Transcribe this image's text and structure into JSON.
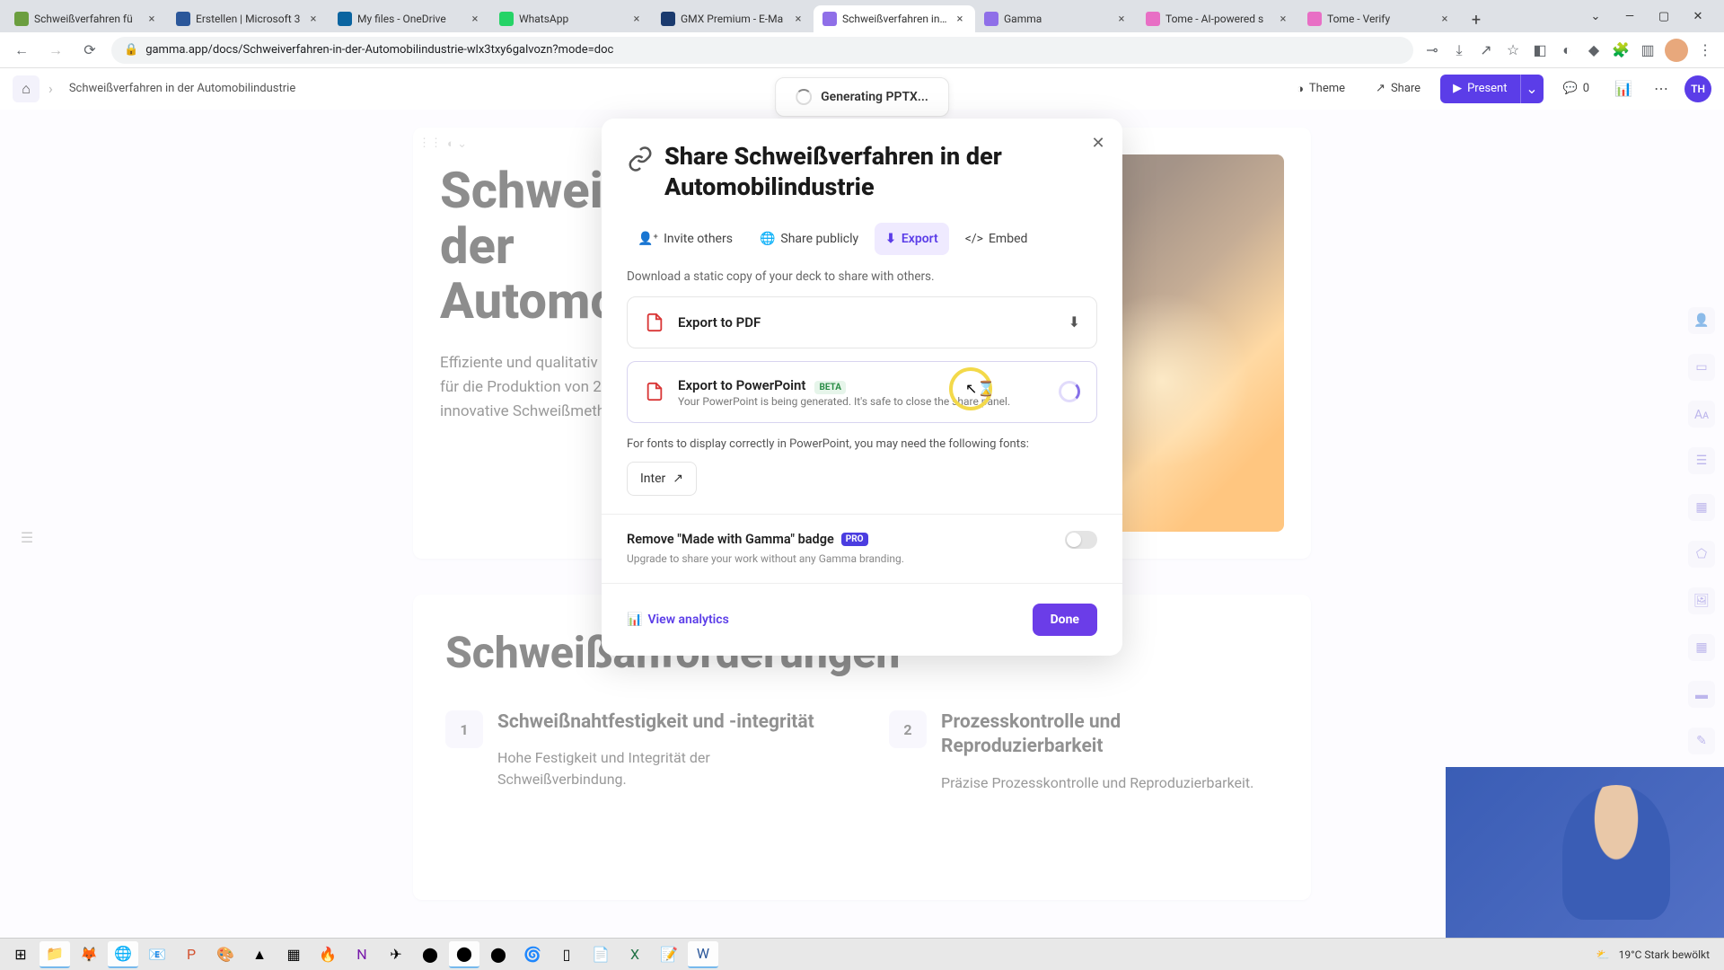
{
  "browser": {
    "tabs": [
      {
        "title": "Schweißverfahren fü",
        "icon": "#6b9e3f"
      },
      {
        "title": "Erstellen | Microsoft 3",
        "icon": "#2b579a"
      },
      {
        "title": "My files - OneDrive",
        "icon": "#0a64a0"
      },
      {
        "title": "WhatsApp",
        "icon": "#25d366"
      },
      {
        "title": "GMX Premium - E-Ma",
        "icon": "#1a3a6e"
      },
      {
        "title": "Schweißverfahren in d",
        "icon": "#8f6fe8"
      },
      {
        "title": "Gamma",
        "icon": "#8f6fe8"
      },
      {
        "title": "Tome - AI-powered s",
        "icon": "#e86fc5"
      },
      {
        "title": "Tome - Verify",
        "icon": "#e86fc5"
      }
    ],
    "url": "gamma.app/docs/Schweiverfahren-in-der-Automobilindustrie-wlx3txy6galvozn?mode=doc"
  },
  "app": {
    "breadcrumb": "Schweißverfahren in der Automobilindustrie",
    "theme": "Theme",
    "share": "Share",
    "present": "Present",
    "comment_count": "0",
    "user_initials": "TH"
  },
  "toast": {
    "text": "Generating PPTX..."
  },
  "doc": {
    "card1_title": "Schweißverfahren in der Automobilindustrie",
    "card1_para": "Effiziente und qualitativ hochwertige Schweißverfahren sind entscheidend für die Produktion von 200.000 Stück pro Jahr. Erfahren Sie mehr über innovative Schweißmethoden.",
    "card2_title": "Schweißanforderungen",
    "col1_num": "1",
    "col1_title": "Schweißnahtfestigkeit und -integrität",
    "col1_body": "Hohe Festigkeit und Integrität der Schweißverbindung.",
    "col2_num": "2",
    "col2_title": "Prozesskontrolle und Reproduzierbarkeit",
    "col2_body": "Präzise Prozesskontrolle und Reproduzierbarkeit."
  },
  "modal": {
    "title": "Share Schweißverfahren in der Automobilindustrie",
    "tab_invite": "Invite others",
    "tab_public": "Share publicly",
    "tab_export": "Export",
    "tab_embed": "Embed",
    "desc": "Download a static copy of your deck to share with others.",
    "pdf": "Export to PDF",
    "ppt": "Export to PowerPoint",
    "ppt_sub": "Your PowerPoint is being generated. It's safe to close the share panel.",
    "beta": "BETA",
    "fonts_note": "For fonts to display correctly in PowerPoint, you may need the following fonts:",
    "font": "Inter",
    "badge_label": "Remove \"Made with Gamma\" badge",
    "pro": "PRO",
    "badge_sub": "Upgrade to share your work without any Gamma branding.",
    "analytics": "View analytics",
    "done": "Done"
  },
  "taskbar": {
    "weather": "19°C  Stark bewölkt"
  }
}
